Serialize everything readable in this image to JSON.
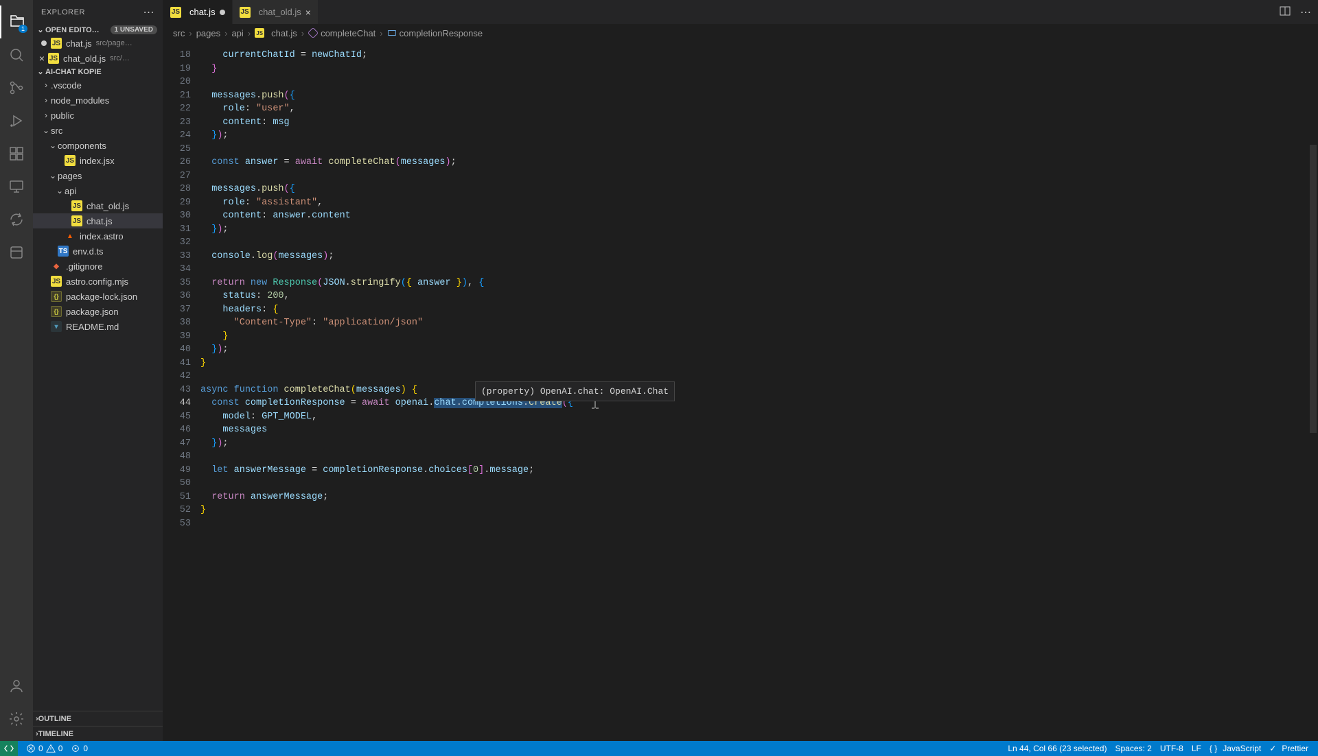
{
  "explorer": {
    "title": "EXPLORER"
  },
  "openEditors": {
    "title": "OPEN EDITO…",
    "unsaved": "1 unsaved",
    "items": [
      {
        "name": "chat.js",
        "hint": "src/page…",
        "dirty": true
      },
      {
        "name": "chat_old.js",
        "hint": "src/…",
        "dirty": false
      }
    ]
  },
  "project": {
    "name": "AI-CHAT KOPIE",
    "tree": [
      {
        "type": "folder",
        "name": ".vscode",
        "depth": 1,
        "open": false
      },
      {
        "type": "folder",
        "name": "node_modules",
        "depth": 1,
        "open": false
      },
      {
        "type": "folder",
        "name": "public",
        "depth": 1,
        "open": false
      },
      {
        "type": "folder",
        "name": "src",
        "depth": 1,
        "open": true
      },
      {
        "type": "folder",
        "name": "components",
        "depth": 2,
        "open": true
      },
      {
        "type": "file",
        "name": "index.jsx",
        "depth": 3,
        "icon": "js"
      },
      {
        "type": "folder",
        "name": "pages",
        "depth": 2,
        "open": true
      },
      {
        "type": "folder",
        "name": "api",
        "depth": 3,
        "open": true
      },
      {
        "type": "file",
        "name": "chat_old.js",
        "depth": 4,
        "icon": "js"
      },
      {
        "type": "file",
        "name": "chat.js",
        "depth": 4,
        "icon": "js",
        "selected": true
      },
      {
        "type": "file",
        "name": "index.astro",
        "depth": 3,
        "icon": "astro"
      },
      {
        "type": "file",
        "name": "env.d.ts",
        "depth": 2,
        "icon": "ts"
      },
      {
        "type": "file",
        "name": ".gitignore",
        "depth": 1,
        "icon": "git"
      },
      {
        "type": "file",
        "name": "astro.config.mjs",
        "depth": 1,
        "icon": "js"
      },
      {
        "type": "file",
        "name": "package-lock.json",
        "depth": 1,
        "icon": "json"
      },
      {
        "type": "file",
        "name": "package.json",
        "depth": 1,
        "icon": "json"
      },
      {
        "type": "file",
        "name": "README.md",
        "depth": 1,
        "icon": "md"
      }
    ]
  },
  "outline": {
    "title": "OUTLINE"
  },
  "timeline": {
    "title": "TIMELINE"
  },
  "tabs": [
    {
      "name": "chat.js",
      "active": true,
      "dirty": true
    },
    {
      "name": "chat_old.js",
      "active": false,
      "dirty": false
    }
  ],
  "breadcrumbs": {
    "path": [
      "src",
      "pages",
      "api",
      "chat.js"
    ],
    "symbols": [
      "completeChat",
      "completionResponse"
    ]
  },
  "activityBadge": "1",
  "hover": "(property) OpenAI.chat: OpenAI.Chat",
  "status": {
    "errors": "0",
    "warnings": "0",
    "ports": "0",
    "cursor": "Ln 44, Col 66 (23 selected)",
    "spaces": "Spaces: 2",
    "encoding": "UTF-8",
    "eol": "LF",
    "lang": "JavaScript",
    "prettier": "Prettier"
  },
  "code": {
    "startLine": 18,
    "endLine": 53
  }
}
